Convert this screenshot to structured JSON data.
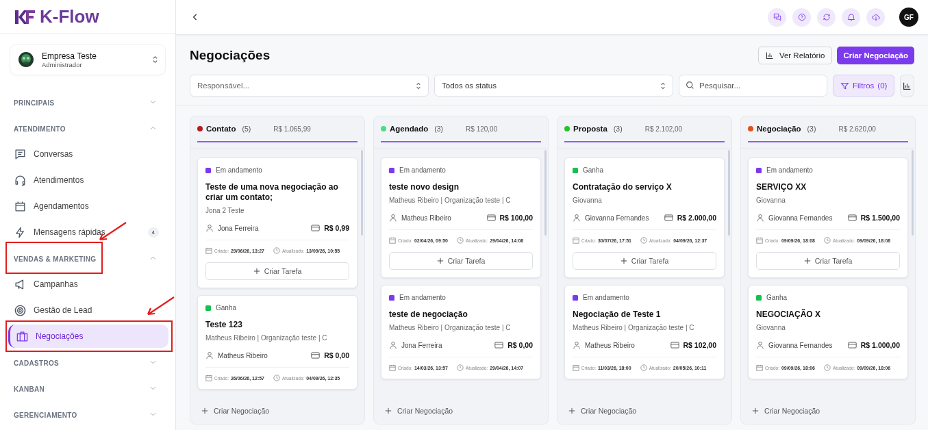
{
  "brand": {
    "name": "K-Flow"
  },
  "company": {
    "name": "Empresa Teste",
    "role": "Administrador"
  },
  "nav": [
    {
      "title": "PRINCIPAIS",
      "expanded": false
    },
    {
      "title": "ATENDIMENTO",
      "expanded": true,
      "items": [
        {
          "label": "Conversas",
          "selected": false
        },
        {
          "label": "Atendimentos",
          "selected": false
        },
        {
          "label": "Agendamentos",
          "selected": false
        },
        {
          "label": "Mensagens rápidas",
          "badge": "4",
          "selected": false
        }
      ]
    },
    {
      "title": "VENDAS & MARKETING",
      "expanded": true,
      "highlighted": true,
      "items": [
        {
          "label": "Campanhas",
          "selected": false
        },
        {
          "label": "Gestão de Lead",
          "selected": false
        },
        {
          "label": "Negociações",
          "selected": true,
          "highlighted": true
        }
      ]
    },
    {
      "title": "CADASTROS",
      "expanded": false
    },
    {
      "title": "KANBAN",
      "expanded": false
    },
    {
      "title": "GERENCIAMENTO",
      "expanded": false
    }
  ],
  "topbar": {
    "avatar": "GF"
  },
  "page": {
    "title": "Negociações",
    "report_button": "Ver Relatório",
    "create_button": "Criar Negociação"
  },
  "filters": {
    "owner_placeholder": "Responsável...",
    "status_value": "Todos os status",
    "search_placeholder": "Pesquisar...",
    "filters_label": "Filtros",
    "filters_count": "(0)"
  },
  "columns": [
    {
      "name": "Contato",
      "count": "(5)",
      "total": "R$ 1.065,99",
      "color": "#b91c1c",
      "add_label": "Criar Negociação",
      "cards": [
        {
          "status": "Em andamento",
          "color": "#7c3aed",
          "title": "Teste de uma nova negociação ao criar um contato;",
          "subtitle": "Jona 2 Teste",
          "owner": "Jona Ferreira",
          "value": "R$ 0,99",
          "created_label": "Criado:",
          "created": "29/06/26, 13:27",
          "updated_label": "Atualizado:",
          "updated": "13/09/26, 10:55",
          "task_button": "Criar Tarefa"
        },
        {
          "status": "Ganha",
          "color": "#16c050",
          "title": "Teste 123",
          "subtitle": "Matheus Ribeiro | Organização teste | C",
          "owner": "Matheus Ribeiro",
          "value": "R$ 0,00",
          "created_label": "Criado:",
          "created": "26/06/26, 12:57",
          "updated_label": "Atualizado:",
          "updated": "04/09/26, 12:35"
        }
      ]
    },
    {
      "name": "Agendado",
      "count": "(3)",
      "total": "R$ 120,00",
      "color": "#4ade80",
      "add_label": "Criar Negociação",
      "cards": [
        {
          "status": "Em andamento",
          "color": "#7c3aed",
          "title": "teste novo design",
          "subtitle": "Matheus Ribeiro | Organização teste | C",
          "owner": "Matheus Ribeiro",
          "value": "R$ 100,00",
          "created_label": "Criado:",
          "created": "02/04/26, 09:50",
          "updated_label": "Atualizado:",
          "updated": "29/04/26, 14:08",
          "task_button": "Criar Tarefa"
        },
        {
          "status": "Em andamento",
          "color": "#7c3aed",
          "title": "teste de negociação",
          "subtitle": "Matheus Ribeiro | Organização teste | C",
          "owner": "Jona Ferreira",
          "value": "R$ 0,00",
          "created_label": "Criado:",
          "created": "14/03/26, 13:57",
          "updated_label": "Atualizado:",
          "updated": "29/04/26, 14:07"
        }
      ]
    },
    {
      "name": "Proposta",
      "count": "(3)",
      "total": "R$ 2.102,00",
      "color": "#22c527",
      "add_label": "Criar Negociação",
      "cards": [
        {
          "status": "Ganha",
          "color": "#16c050",
          "title": "Contratação do serviço X",
          "subtitle": "Giovanna",
          "owner": "Giovanna Fernandes",
          "value": "R$ 2.000,00",
          "created_label": "Criado:",
          "created": "30/07/26, 17:51",
          "updated_label": "Atualizado:",
          "updated": "04/09/26, 12:37",
          "task_button": "Criar Tarefa"
        },
        {
          "status": "Em andamento",
          "color": "#7c3aed",
          "title": "Negociação de Teste 1",
          "subtitle": "Matheus Ribeiro | Organização teste | C",
          "owner": "Matheus Ribeiro",
          "value": "R$ 102,00",
          "created_label": "Criado:",
          "created": "11/03/26, 18:00",
          "updated_label": "Atualizado:",
          "updated": "20/05/26, 10:11"
        }
      ]
    },
    {
      "name": "Negociação",
      "count": "(3)",
      "total": "R$ 2.620,00",
      "color": "#e0521f",
      "add_label": "Criar Negociação",
      "cards": [
        {
          "status": "Em andamento",
          "color": "#7c3aed",
          "title": "SERVIÇO XX",
          "subtitle": "Giovanna",
          "owner": "Giovanna Fernandes",
          "value": "R$ 1.500,00",
          "created_label": "Criado:",
          "created": "09/09/26, 18:08",
          "updated_label": "Atualizado:",
          "updated": "09/09/26, 18:08",
          "task_button": "Criar Tarefa"
        },
        {
          "status": "Ganha",
          "color": "#16c050",
          "title": "NEGOCIAÇÃO X",
          "subtitle": "Giovanna",
          "owner": "Giovanna Fernandes",
          "value": "R$ 1.000,00",
          "created_label": "Criado:",
          "created": "09/09/26, 18:06",
          "updated_label": "Atualizado:",
          "updated": "09/09/26, 18:06"
        }
      ]
    }
  ]
}
